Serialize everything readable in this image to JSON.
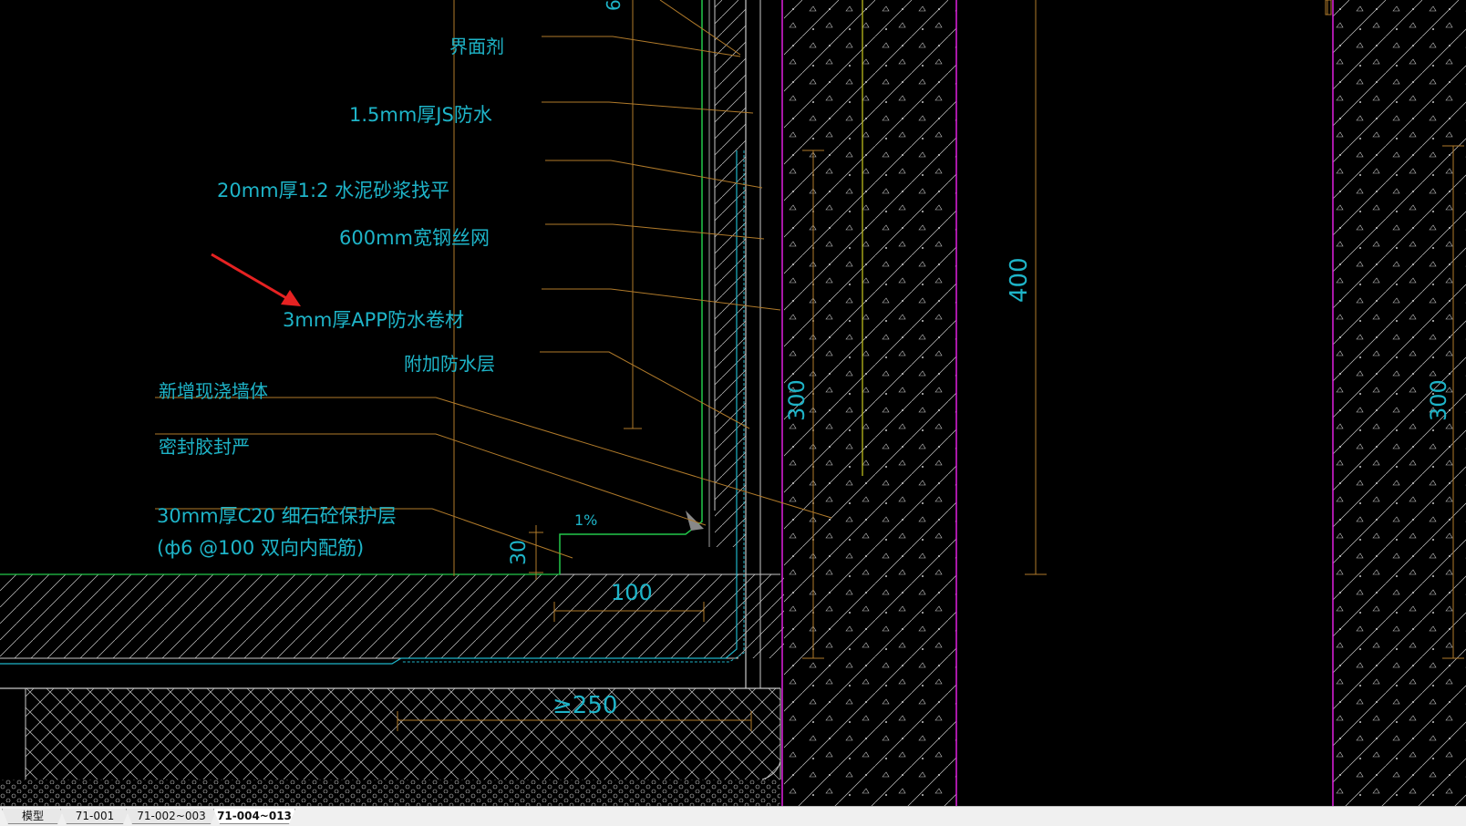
{
  "drawing": {
    "labels": {
      "interface_agent": "界面剂",
      "js_waterproof": "1.5mm厚JS防水",
      "mortar": "20mm厚1:2 水泥砂浆找平",
      "steel_mesh": "600mm宽钢丝网",
      "app_membrane": "3mm厚APP防水卷材",
      "extra_layer": "附加防水层",
      "new_wall": "新增现浇墙体",
      "sealant": "密封胶封严",
      "protection_layer": "30mm厚C20 细石砼保护层",
      "rebar": "(ф6 @100 双向内配筋)"
    },
    "dimensions": {
      "d30": "30",
      "slope": "1%",
      "d100": "100",
      "d250": "≥250",
      "d300_left": "300",
      "d400": "400",
      "d300_right": "300",
      "top_cut": "6"
    },
    "colors": {
      "background": "#000000",
      "text": "#1eb4c8",
      "leader": "#b07a2a",
      "wall_line": "#e020e0",
      "green": "#22c84a",
      "yellow": "#c8c81e",
      "hatch": "#c8c8c8"
    }
  },
  "tabs": [
    {
      "label": "模型",
      "active": false
    },
    {
      "label": "71-001",
      "active": false
    },
    {
      "label": "71-002~003",
      "active": false
    },
    {
      "label": "71-004~013",
      "active": true
    }
  ]
}
